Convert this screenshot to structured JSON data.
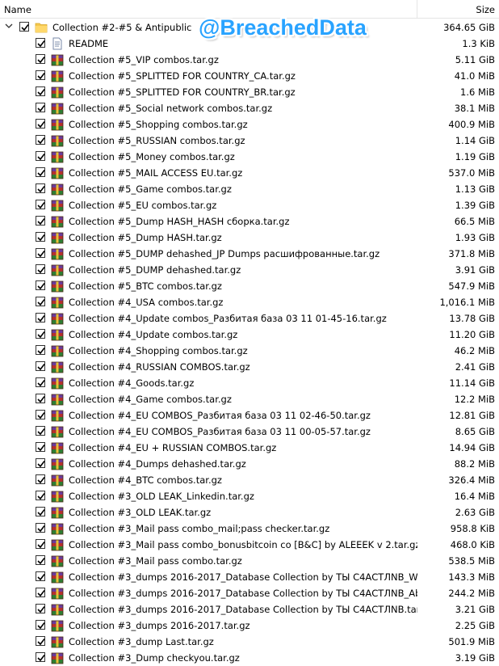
{
  "header": {
    "name_col": "Name",
    "size_col": "Size"
  },
  "watermark": "@BreachedData",
  "root": {
    "name": "Collection #2-#5 & Antipublic",
    "size": "364.65 GiB",
    "icon": "folder-icon",
    "checked": true,
    "expanded": true
  },
  "files": [
    {
      "name": "README",
      "size": "1.3 KiB",
      "icon": "document-icon"
    },
    {
      "name": "Collection #5_VIP combos.tar.gz",
      "size": "5.11 GiB",
      "icon": "archive-icon"
    },
    {
      "name": "Collection #5_SPLITTED FOR COUNTRY_CA.tar.gz",
      "size": "41.0 MiB",
      "icon": "archive-icon"
    },
    {
      "name": "Collection #5_SPLITTED FOR COUNTRY_BR.tar.gz",
      "size": "1.6 MiB",
      "icon": "archive-icon"
    },
    {
      "name": "Collection #5_Social network combos.tar.gz",
      "size": "38.1 MiB",
      "icon": "archive-icon"
    },
    {
      "name": "Collection #5_Shopping combos.tar.gz",
      "size": "400.9 MiB",
      "icon": "archive-icon"
    },
    {
      "name": "Collection #5_RUSSIAN combos.tar.gz",
      "size": "1.14 GiB",
      "icon": "archive-icon"
    },
    {
      "name": "Collection #5_Money combos.tar.gz",
      "size": "1.19 GiB",
      "icon": "archive-icon"
    },
    {
      "name": "Collection #5_MAIL ACCESS EU.tar.gz",
      "size": "537.0 MiB",
      "icon": "archive-icon"
    },
    {
      "name": "Collection #5_Game combos.tar.gz",
      "size": "1.13 GiB",
      "icon": "archive-icon"
    },
    {
      "name": "Collection #5_EU combos.tar.gz",
      "size": "1.39 GiB",
      "icon": "archive-icon"
    },
    {
      "name": "Collection #5_Dump HASH_HASH сборка.tar.gz",
      "size": "66.5 MiB",
      "icon": "archive-icon"
    },
    {
      "name": "Collection #5_Dump HASH.tar.gz",
      "size": "1.93 GiB",
      "icon": "archive-icon"
    },
    {
      "name": "Collection #5_DUMP dehashed_JP Dumps расшифрованные.tar.gz",
      "size": "371.8 MiB",
      "icon": "archive-icon"
    },
    {
      "name": "Collection #5_DUMP dehashed.tar.gz",
      "size": "3.91 GiB",
      "icon": "archive-icon"
    },
    {
      "name": "Collection #5_BTC combos.tar.gz",
      "size": "547.9 MiB",
      "icon": "archive-icon"
    },
    {
      "name": "Collection #4_USA combos.tar.gz",
      "size": "1,016.1 MiB",
      "icon": "archive-icon"
    },
    {
      "name": "Collection #4_Update combos_Разбитая база 03 11 01-45-16.tar.gz",
      "size": "13.78 GiB",
      "icon": "archive-icon"
    },
    {
      "name": "Collection #4_Update combos.tar.gz",
      "size": "11.20 GiB",
      "icon": "archive-icon"
    },
    {
      "name": "Collection #4_Shopping combos.tar.gz",
      "size": "46.2 MiB",
      "icon": "archive-icon"
    },
    {
      "name": "Collection #4_RUSSIAN COMBOS.tar.gz",
      "size": "2.41 GiB",
      "icon": "archive-icon"
    },
    {
      "name": "Collection #4_Goods.tar.gz",
      "size": "11.14 GiB",
      "icon": "archive-icon"
    },
    {
      "name": "Collection #4_Game combos.tar.gz",
      "size": "12.2 MiB",
      "icon": "archive-icon"
    },
    {
      "name": "Collection #4_EU COMBOS_Разбитая база 03 11 02-46-50.tar.gz",
      "size": "12.81 GiB",
      "icon": "archive-icon"
    },
    {
      "name": "Collection #4_EU COMBOS_Разбитая база 03 11 00-05-57.tar.gz",
      "size": "8.65 GiB",
      "icon": "archive-icon"
    },
    {
      "name": "Collection #4_EU + RUSSIAN COMBOS.tar.gz",
      "size": "14.94 GiB",
      "icon": "archive-icon"
    },
    {
      "name": "Collection #4_Dumps dehashed.tar.gz",
      "size": "88.2 MiB",
      "icon": "archive-icon"
    },
    {
      "name": "Collection #4_BTC combos.tar.gz",
      "size": "326.4 MiB",
      "icon": "archive-icon"
    },
    {
      "name": "Collection #3_OLD LEAK_Linkedin.tar.gz",
      "size": "16.4 MiB",
      "icon": "archive-icon"
    },
    {
      "name": "Collection #3_OLD LEAK.tar.gz",
      "size": "2.63 GiB",
      "icon": "archive-icon"
    },
    {
      "name": "Collection #3_Mail pass combo_mail;pass checker.tar.gz",
      "size": "958.8 KiB",
      "icon": "archive-icon"
    },
    {
      "name": "Collection #3_Mail pass combo_bonusbitcoin co [B&C] by ALEEEK v 2.tar.gz",
      "size": "468.0 KiB",
      "icon": "archive-icon"
    },
    {
      "name": "Collection #3_Mail pass combo.tar.gz",
      "size": "538.5 MiB",
      "icon": "archive-icon"
    },
    {
      "name": "Collection #3_dumps 2016-2017_Database Collection by ТЫ С4АСТЛNB_Wildsta...",
      "size": "143.3 MiB",
      "icon": "archive-icon"
    },
    {
      "name": "Collection #3_dumps 2016-2017_Database Collection by ТЫ С4АСТЛNB_Abuse...",
      "size": "244.2 MiB",
      "icon": "archive-icon"
    },
    {
      "name": "Collection #3_dumps 2016-2017_Database Collection by ТЫ С4АСТЛNB.tar.gz",
      "size": "3.21 GiB",
      "icon": "archive-icon"
    },
    {
      "name": "Collection #3_dumps 2016-2017.tar.gz",
      "size": "2.25 GiB",
      "icon": "archive-icon"
    },
    {
      "name": "Collection #3_dump Last.tar.gz",
      "size": "501.9 MiB",
      "icon": "archive-icon"
    },
    {
      "name": "Collection #3_Dump checkyou.tar.gz",
      "size": "3.19 GiB",
      "icon": "archive-icon"
    }
  ]
}
